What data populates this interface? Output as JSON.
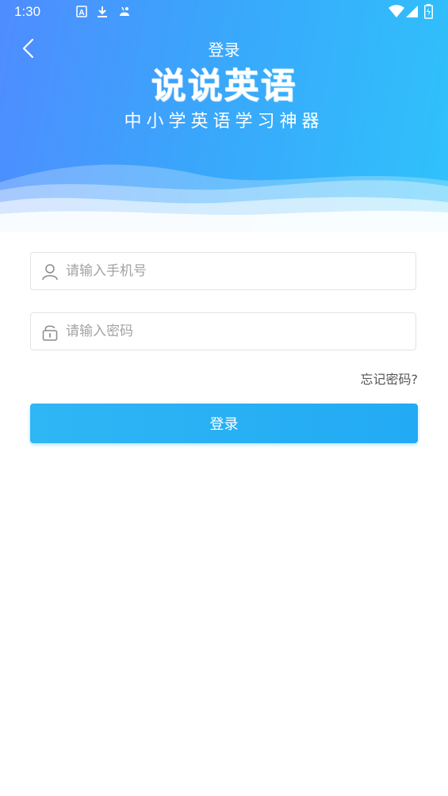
{
  "status_bar": {
    "time": "1:30",
    "icons": [
      "text-a-icon",
      "download-icon",
      "android-icon",
      "wifi-icon",
      "signal-icon",
      "battery-icon"
    ]
  },
  "header": {
    "nav_title": "登录",
    "app_name": "说说英语",
    "slogan": "中小学英语学习神器",
    "back_icon": "chevron-left-icon",
    "gradient_colors": [
      "#4f8cff",
      "#2fc2fb"
    ]
  },
  "form": {
    "phone": {
      "placeholder": "请输入手机号",
      "value": "",
      "icon": "user-icon"
    },
    "password": {
      "placeholder": "请输入密码",
      "value": "",
      "icon": "lock-icon"
    },
    "forgot_label": "忘记密码?",
    "login_label": "登录",
    "accent_color": "#22aaf4"
  }
}
